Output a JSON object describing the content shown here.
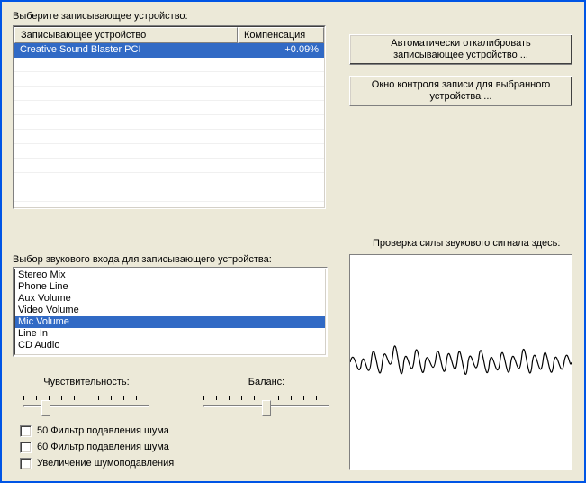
{
  "device_section": {
    "label": "Выберите записывающее устройство:",
    "col_device": "Записывающее устройство",
    "col_comp": "Компенсация",
    "rows": [
      {
        "name": "Creative Sound Blaster PCI",
        "comp": "+0.09%"
      }
    ]
  },
  "buttons": {
    "calibrate": "Автоматически откалибровать записывающее устройство ...",
    "control": "Окно контроля записи для выбранного устройства ..."
  },
  "input_section": {
    "label": "Выбор звукового входа для записывающего устройства:",
    "items": [
      "Stereo Mix",
      "Phone Line",
      "Aux Volume",
      "Video Volume",
      "Mic Volume",
      "Line In",
      "CD Audio"
    ],
    "selected_index": 4
  },
  "sliders": {
    "sensitivity": "Чувствительность:",
    "balance": "Баланс:"
  },
  "checks": {
    "filter50": "50 Фильтр подавления шума",
    "filter60": "60 Фильтр подавления шума",
    "boost": "Увеличение шумоподавления"
  },
  "signal": {
    "label": "Проверка силы звукового сигнала здесь:"
  }
}
